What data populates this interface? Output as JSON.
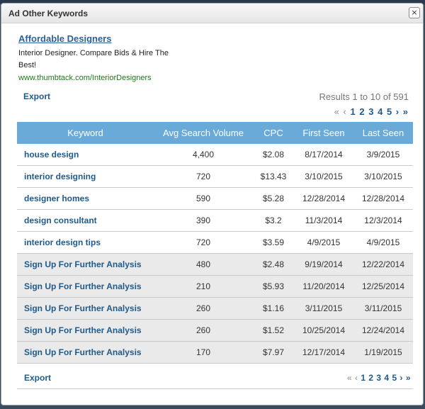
{
  "dialog": {
    "title": "Ad Other Keywords",
    "close_label": "×"
  },
  "ad": {
    "headline": "Affordable Designers",
    "description": "Interior Designer. Compare Bids & Hire The Best!",
    "url": "www.thumbtack.com/InteriorDesigners"
  },
  "toolbar": {
    "export_label": "Export",
    "results_text": "Results 1 to 10 of 591"
  },
  "pager": {
    "first": "«",
    "prev": "‹",
    "pages": [
      "1",
      "2",
      "3",
      "4",
      "5"
    ],
    "next": "›",
    "last": "»"
  },
  "table": {
    "headers": [
      "Keyword",
      "Avg Search Volume",
      "CPC",
      "First Seen",
      "Last Seen"
    ],
    "rows": [
      [
        "house design",
        "4,400",
        "$2.08",
        "8/17/2014",
        "3/9/2015"
      ],
      [
        "interior designing",
        "720",
        "$13.43",
        "3/10/2015",
        "3/10/2015"
      ],
      [
        "designer homes",
        "590",
        "$5.28",
        "12/28/2014",
        "12/28/2014"
      ],
      [
        "design consultant",
        "390",
        "$3.2",
        "11/3/2014",
        "12/3/2014"
      ],
      [
        "interior design tips",
        "720",
        "$3.59",
        "4/9/2015",
        "4/9/2015"
      ],
      [
        "Sign Up For Further Analysis",
        "480",
        "$2.48",
        "9/19/2014",
        "12/22/2014"
      ],
      [
        "Sign Up For Further Analysis",
        "210",
        "$5.93",
        "11/20/2014",
        "12/25/2014"
      ],
      [
        "Sign Up For Further Analysis",
        "260",
        "$1.16",
        "3/11/2015",
        "3/11/2015"
      ],
      [
        "Sign Up For Further Analysis",
        "260",
        "$1.52",
        "10/25/2014",
        "12/24/2014"
      ],
      [
        "Sign Up For Further Analysis",
        "170",
        "$7.97",
        "12/17/2014",
        "1/19/2015"
      ]
    ]
  },
  "footer": {
    "export_label": "Export"
  },
  "colors": {
    "header_bg": "#6aaad9",
    "link": "#1f5a8a",
    "locked_row_bg": "#eaeaea",
    "ad_url": "#1b7a1b"
  }
}
